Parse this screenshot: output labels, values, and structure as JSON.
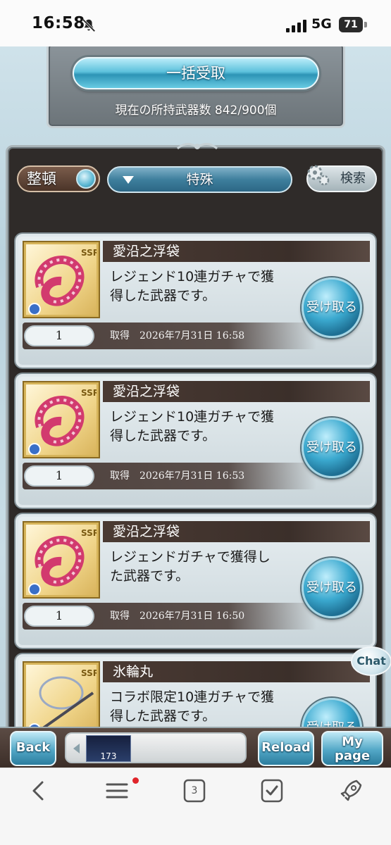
{
  "status": {
    "time": "16:58",
    "network": "5G",
    "battery": "71"
  },
  "panel": {
    "receive_all": "一括受取",
    "weapon_count": "現在の所持武器数 842/900個"
  },
  "toolbar": {
    "sort": "整頓",
    "filter": "特殊",
    "search": "検索"
  },
  "items": [
    {
      "name": "愛沿之浮袋",
      "desc_line1": "レジェンド10連ガチャで獲",
      "desc_line2": "得した武器です。",
      "count": "1",
      "meta": "取得　2026年7月31日 16:58",
      "rarity": "SSR",
      "claim": "受け取る"
    },
    {
      "name": "愛沿之浮袋",
      "desc_line1": "レジェンド10連ガチャで獲",
      "desc_line2": "得した武器です。",
      "count": "1",
      "meta": "取得　2026年7月31日 16:53",
      "rarity": "SSR",
      "claim": "受け取る"
    },
    {
      "name": "愛沿之浮袋",
      "desc_line1": "レジェンドガチャで獲得し",
      "desc_line2": "た武器です。",
      "count": "1",
      "meta": "取得　2026年7月31日 16:50",
      "rarity": "SSR",
      "claim": "受け取る"
    },
    {
      "name": "氷輪丸",
      "desc_line1": "コラボ限定10連ガチャで獲",
      "desc_line2": "得した武器です。",
      "count": "",
      "meta": "",
      "rarity": "SSR",
      "claim": "受け取る"
    }
  ],
  "chat": "Chat",
  "bottom_nav": {
    "back": "Back",
    "mini_value": "173",
    "reload": "Reload",
    "mypage_line1": "My",
    "mypage_line2": "page"
  },
  "browser": {
    "tab_count": "3"
  }
}
